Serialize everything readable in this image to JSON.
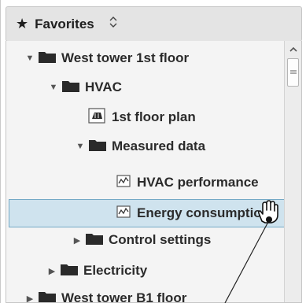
{
  "favorites": {
    "label": "Favorites"
  },
  "tree": {
    "west_tower_1f": "West tower 1st floor",
    "hvac": "HVAC",
    "floor_plan": "1st floor plan",
    "measured_data": "Measured data",
    "hvac_performance": "HVAC performance",
    "energy_consumption": "Energy consumption",
    "control_settings": "Control settings",
    "electricity": "Electricity",
    "west_tower_b1": "West tower B1 floor"
  }
}
